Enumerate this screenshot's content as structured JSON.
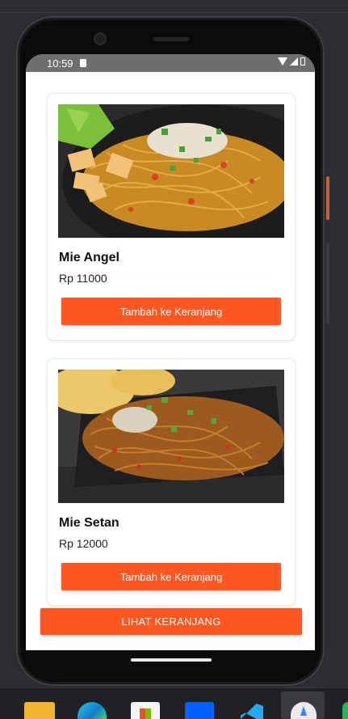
{
  "status_bar": {
    "time": "10:59"
  },
  "menu_items": [
    {
      "name": "Mie Angel",
      "price": "Rp 11000",
      "add_label": "Tambah ke Keranjang"
    },
    {
      "name": "Mie Setan",
      "price": "Rp 12000",
      "add_label": "Tambah ke Keranjang"
    }
  ],
  "cart_button": {
    "label": "LIHAT KERANJANG"
  },
  "colors": {
    "accent": "#ff5722",
    "card_bg": "#ffffff",
    "ide_bg": "#2b2d30"
  },
  "icons": {
    "status": [
      "sd-card-icon",
      "wifi-icon",
      "signal-icon",
      "battery-icon"
    ],
    "taskbar": [
      "file-explorer-icon",
      "edge-icon",
      "store-icon",
      "dropbox-icon",
      "vscode-icon",
      "android-studio-icon"
    ]
  }
}
